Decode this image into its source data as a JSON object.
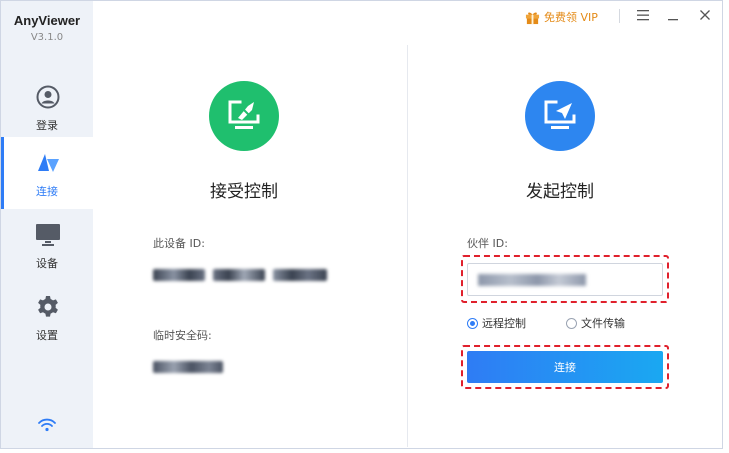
{
  "app": {
    "name": "AnyViewer",
    "version": "V3.1.0"
  },
  "titlebar": {
    "vip_label": "免费领 VIP"
  },
  "sidebar": {
    "items": [
      {
        "label": "登录",
        "icon": "user-icon"
      },
      {
        "label": "连接",
        "icon": "connect-icon",
        "active": true
      },
      {
        "label": "设备",
        "icon": "monitor-icon"
      },
      {
        "label": "设置",
        "icon": "gear-icon"
      }
    ]
  },
  "receive": {
    "title": "接受控制",
    "device_id_label": "此设备 ID:",
    "temp_code_label": "临时安全码:"
  },
  "initiate": {
    "title": "发起控制",
    "partner_id_label": "伙伴 ID:",
    "options": [
      {
        "label": "远程控制",
        "selected": true
      },
      {
        "label": "文件传输",
        "selected": false
      }
    ],
    "connect_label": "连接"
  },
  "colors": {
    "accent": "#2e7cf6",
    "receive_circle": "#1fbf6e",
    "initiate_circle": "#2d86f0",
    "highlight": "#e0202c",
    "vip": "#e48b18"
  }
}
